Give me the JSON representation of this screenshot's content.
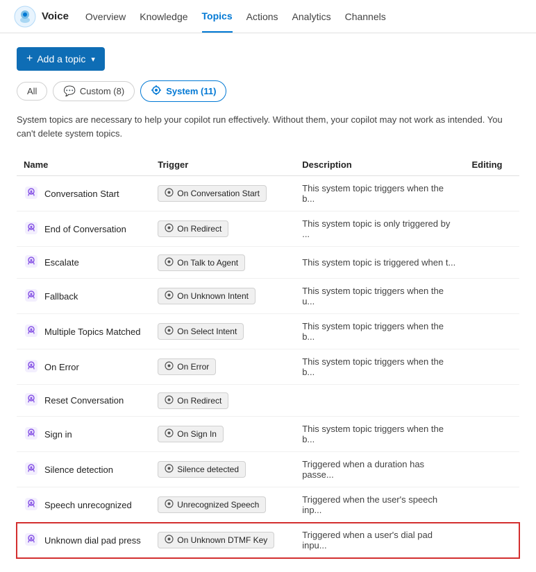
{
  "nav": {
    "appName": "Voice",
    "links": [
      {
        "label": "Overview",
        "active": false
      },
      {
        "label": "Knowledge",
        "active": false
      },
      {
        "label": "Topics",
        "active": true
      },
      {
        "label": "Actions",
        "active": false
      },
      {
        "label": "Analytics",
        "active": false
      },
      {
        "label": "Channels",
        "active": false
      }
    ]
  },
  "toolbar": {
    "addTopicLabel": "Add a topic"
  },
  "filters": {
    "all": "All",
    "custom": "Custom (8)",
    "system": "System (11)"
  },
  "infoText": "System topics are necessary to help your copilot run effectively. Without them, your copilot may not work as intended. You can't delete system topics.",
  "table": {
    "headers": [
      "Name",
      "Trigger",
      "Description",
      "Editing"
    ],
    "rows": [
      {
        "name": "Conversation Start",
        "trigger": "On Conversation Start",
        "description": "This system topic triggers when the b...",
        "highlighted": false
      },
      {
        "name": "End of Conversation",
        "trigger": "On Redirect",
        "description": "This system topic is only triggered by ...",
        "highlighted": false
      },
      {
        "name": "Escalate",
        "trigger": "On Talk to Agent",
        "description": "This system topic is triggered when t...",
        "highlighted": false
      },
      {
        "name": "Fallback",
        "trigger": "On Unknown Intent",
        "description": "This system topic triggers when the u...",
        "highlighted": false
      },
      {
        "name": "Multiple Topics Matched",
        "trigger": "On Select Intent",
        "description": "This system topic triggers when the b...",
        "highlighted": false
      },
      {
        "name": "On Error",
        "trigger": "On Error",
        "description": "This system topic triggers when the b...",
        "highlighted": false
      },
      {
        "name": "Reset Conversation",
        "trigger": "On Redirect",
        "description": "",
        "highlighted": false
      },
      {
        "name": "Sign in",
        "trigger": "On Sign In",
        "description": "This system topic triggers when the b...",
        "highlighted": false
      },
      {
        "name": "Silence detection",
        "trigger": "Silence detected",
        "description": "Triggered when a duration has passe...",
        "highlighted": false
      },
      {
        "name": "Speech unrecognized",
        "trigger": "Unrecognized Speech",
        "description": "Triggered when the user's speech inp...",
        "highlighted": false
      },
      {
        "name": "Unknown dial pad press",
        "trigger": "On Unknown DTMF Key",
        "description": "Triggered when a user's dial pad inpu...",
        "highlighted": true
      }
    ]
  }
}
